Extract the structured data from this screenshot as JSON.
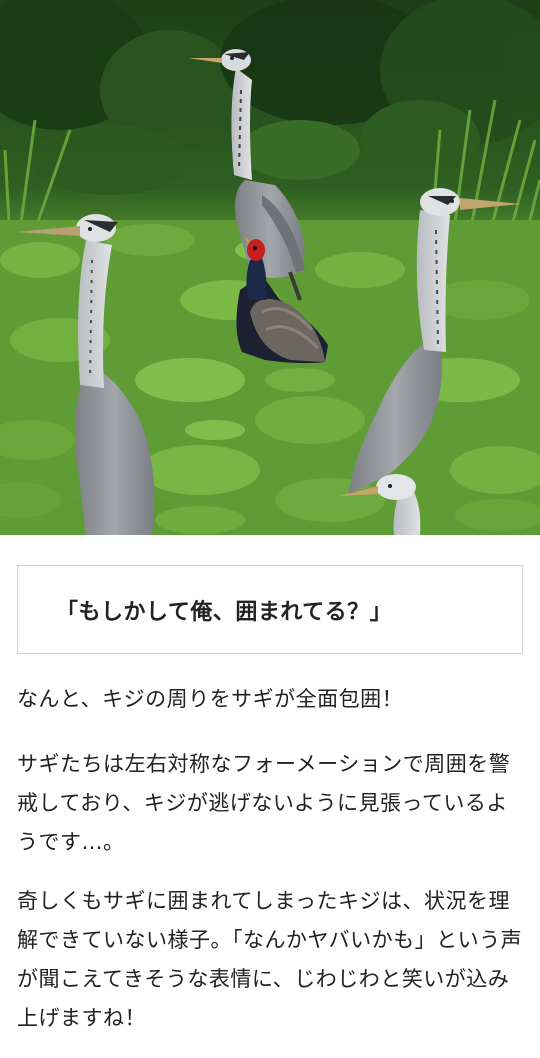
{
  "photo": {
    "alt_subject": "heron-and-pheasant-photo"
  },
  "quote": {
    "text": "「もしかして俺、囲まれてる？」"
  },
  "article": {
    "paragraphs": [
      "なんと、キジの周りをサギが全面包囲！",
      "サギたちは左右対称なフォーメーションで周囲を警戒しており、キジが逃げないように見張っているようです…。",
      "奇しくもサギに囲まれてしまったキジは、状況を理解できていない様子。「なんかヤバいかも」という声が聞こえてきそうな表情に、じわじわと笑いが込み上げますね！"
    ]
  },
  "colors": {
    "grass": "#5d9a34",
    "foliage_dark": "#1f4a1c",
    "heron_gray": "#8e9296",
    "pheasant_dark": "#1b1d2a",
    "pheasant_red": "#c81e1e",
    "border": "#cfcfcf"
  }
}
